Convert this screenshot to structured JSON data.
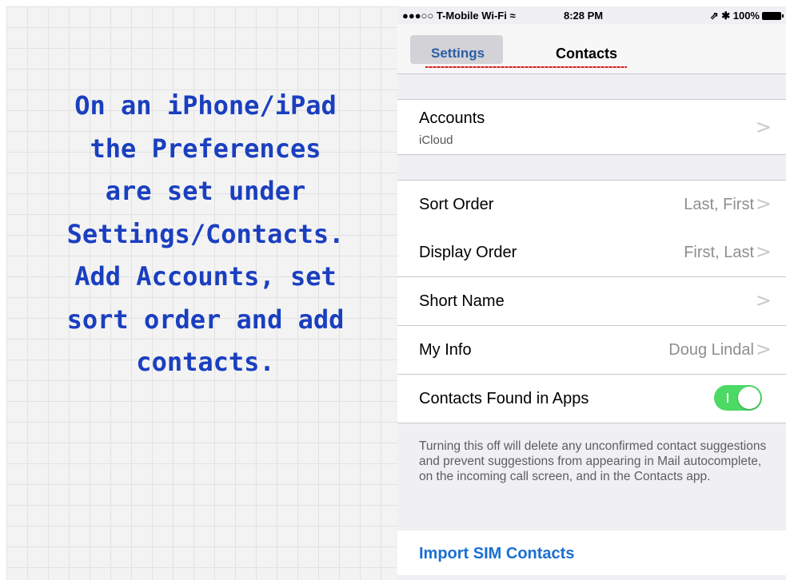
{
  "slide": {
    "caption_lines": [
      "On an iPhone/iPad",
      "the Preferences",
      "are set under",
      "Settings/Contacts.",
      "Add Accounts, set",
      "sort order and add",
      "contacts."
    ]
  },
  "status_bar": {
    "carrier": "●●●○○ T-Mobile Wi-Fi",
    "wifi_icon": "wifi-icon",
    "time": "8:28 PM",
    "right": "⇗ ✱ 100%"
  },
  "nav": {
    "back_label": "Settings",
    "title": "Contacts"
  },
  "accounts": {
    "label": "Accounts",
    "subtitle": "iCloud"
  },
  "rows": [
    {
      "label": "Sort Order",
      "value": "Last, First"
    },
    {
      "label": "Display Order",
      "value": "First, Last"
    },
    {
      "label": "Short Name",
      "value": ""
    },
    {
      "label": "My Info",
      "value": "Doug Lindal"
    }
  ],
  "contacts_found": {
    "label": "Contacts Found in Apps",
    "toggle_on": true,
    "toggle_color": "#4cd964"
  },
  "footnote": "Turning this off will delete any unconfirmed contact suggestions and prevent suggestions from appearing in Mail autocomplete, on the incoming call screen, and in the Contacts app.",
  "import": {
    "label": "Import SIM Contacts"
  },
  "chevron": ">"
}
